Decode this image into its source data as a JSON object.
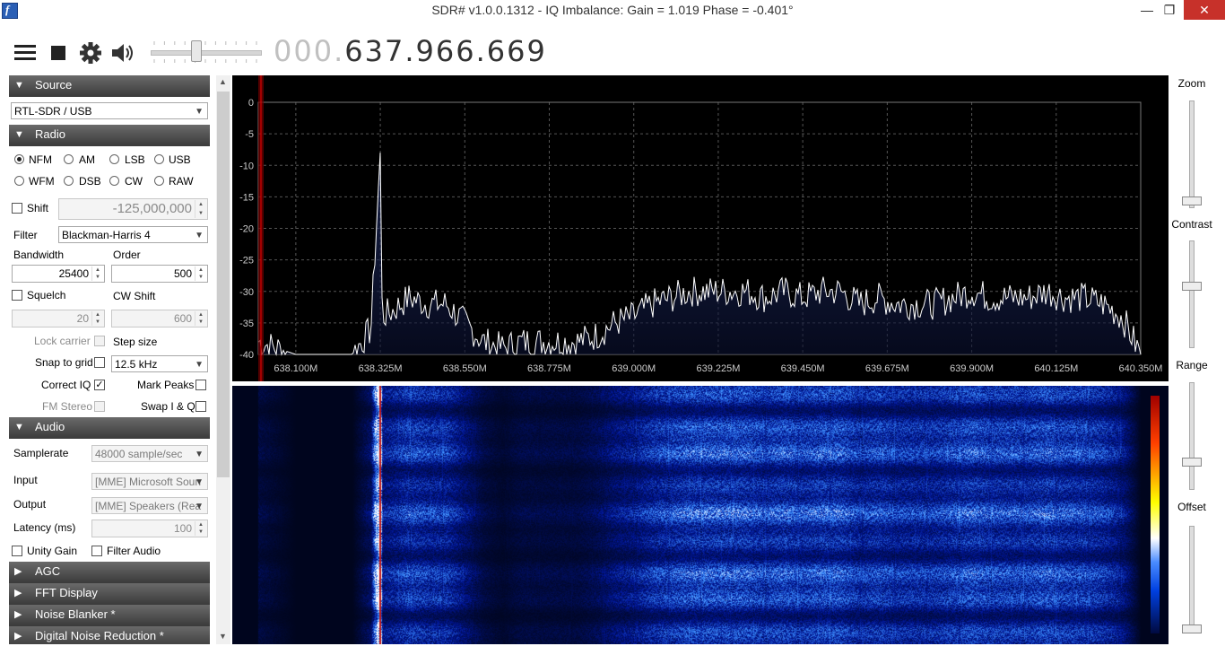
{
  "window": {
    "title": "SDR# v1.0.0.1312 - IQ Imbalance: Gain = 1.019 Phase = -0.401°",
    "app_icon_glyph": "f"
  },
  "toolbar": {
    "menu_icon": "hamburger-icon",
    "stop_icon": "stop-icon",
    "settings_icon": "gear-icon",
    "audio_icon": "speaker-icon",
    "volume": 0.4,
    "frequency_prefix": "000.",
    "frequency_main": "637.966.669"
  },
  "source": {
    "header": "Source",
    "device": "RTL-SDR / USB"
  },
  "radio": {
    "header": "Radio",
    "modes": [
      {
        "label": "NFM",
        "selected": true
      },
      {
        "label": "AM",
        "selected": false
      },
      {
        "label": "LSB",
        "selected": false
      },
      {
        "label": "USB",
        "selected": false
      },
      {
        "label": "WFM",
        "selected": false
      },
      {
        "label": "DSB",
        "selected": false
      },
      {
        "label": "CW",
        "selected": false
      },
      {
        "label": "RAW",
        "selected": false
      }
    ],
    "shift_label": "Shift",
    "shift_value": "-125,000,000",
    "filter_label": "Filter",
    "filter_value": "Blackman-Harris 4",
    "bandwidth_label": "Bandwidth",
    "bandwidth_value": "25400",
    "order_label": "Order",
    "order_value": "500",
    "squelch_label": "Squelch",
    "squelch_value": "20",
    "cwshift_label": "CW Shift",
    "cwshift_value": "600",
    "lock_carrier_label": "Lock carrier",
    "step_size_label": "Step size",
    "snap_label": "Snap to grid",
    "step_value": "12.5 kHz",
    "correct_iq_label": "Correct IQ",
    "mark_peaks_label": "Mark Peaks",
    "fm_stereo_label": "FM Stereo",
    "swap_iq_label": "Swap I & Q",
    "check_mark": "✓"
  },
  "audio": {
    "header": "Audio",
    "samplerate_label": "Samplerate",
    "samplerate_value": "48000 sample/sec",
    "input_label": "Input",
    "input_value": "[MME] Microsoft Soun",
    "output_label": "Output",
    "output_value": "[MME] Speakers (Rea",
    "latency_label": "Latency (ms)",
    "latency_value": "100",
    "unity_gain_label": "Unity Gain",
    "filter_audio_label": "Filter Audio"
  },
  "collapsed_sections": [
    "AGC",
    "FFT Display",
    "Noise Blanker *",
    "Digital Noise Reduction *"
  ],
  "side_controls": {
    "zoom": "Zoom",
    "contrast": "Contrast",
    "range": "Range",
    "offset": "Offset"
  },
  "chart_data": {
    "type": "line",
    "y_ticks": [
      "0",
      "-5",
      "-10",
      "-15",
      "-20",
      "-25",
      "-30",
      "-35",
      "-40"
    ],
    "x_ticks": [
      "638.100M",
      "638.325M",
      "638.550M",
      "638.775M",
      "639.000M",
      "639.225M",
      "639.450M",
      "639.675M",
      "639.900M",
      "640.125M",
      "640.350M"
    ],
    "ylim": [
      -40,
      0
    ],
    "xlim_mhz": [
      638.0,
      640.35
    ],
    "ylabel": "",
    "xlabel": "",
    "grid": true,
    "series": [
      {
        "x": [
          638.0,
          638.05,
          638.1,
          638.15,
          638.2,
          638.25,
          638.3,
          638.325,
          638.33,
          638.36,
          638.4,
          638.45,
          638.5,
          638.55,
          638.6,
          638.65,
          638.7,
          638.75,
          638.8,
          638.85,
          638.9,
          638.95,
          639.0,
          639.05,
          639.1,
          639.15,
          639.2,
          639.25,
          639.3,
          639.35,
          639.4,
          639.45,
          639.5,
          639.55,
          639.6,
          639.65,
          639.7,
          639.75,
          639.8,
          639.85,
          639.9,
          639.95,
          640.0,
          640.05,
          640.1,
          640.15,
          640.2,
          640.25,
          640.3,
          640.35
        ],
        "y": [
          -38,
          -39,
          -40,
          -40,
          -40,
          -40,
          -36,
          -8,
          -34,
          -33,
          -31,
          -32,
          -32,
          -35,
          -38,
          -39,
          -38,
          -38,
          -38,
          -38,
          -37,
          -35,
          -34,
          -32,
          -31,
          -30,
          -30,
          -30,
          -30,
          -31,
          -30,
          -31,
          -30,
          -30,
          -32,
          -31,
          -32,
          -32,
          -32,
          -31,
          -30,
          -31,
          -31,
          -31,
          -30,
          -31,
          -31,
          -32,
          -34,
          -40
        ]
      }
    ]
  },
  "waterfall_palette": [
    "#000000",
    "#000a40",
    "#0020a0",
    "#0040e0",
    "#4a8cff",
    "#ffffff",
    "#ffff00",
    "#ff8000",
    "#a00000"
  ]
}
